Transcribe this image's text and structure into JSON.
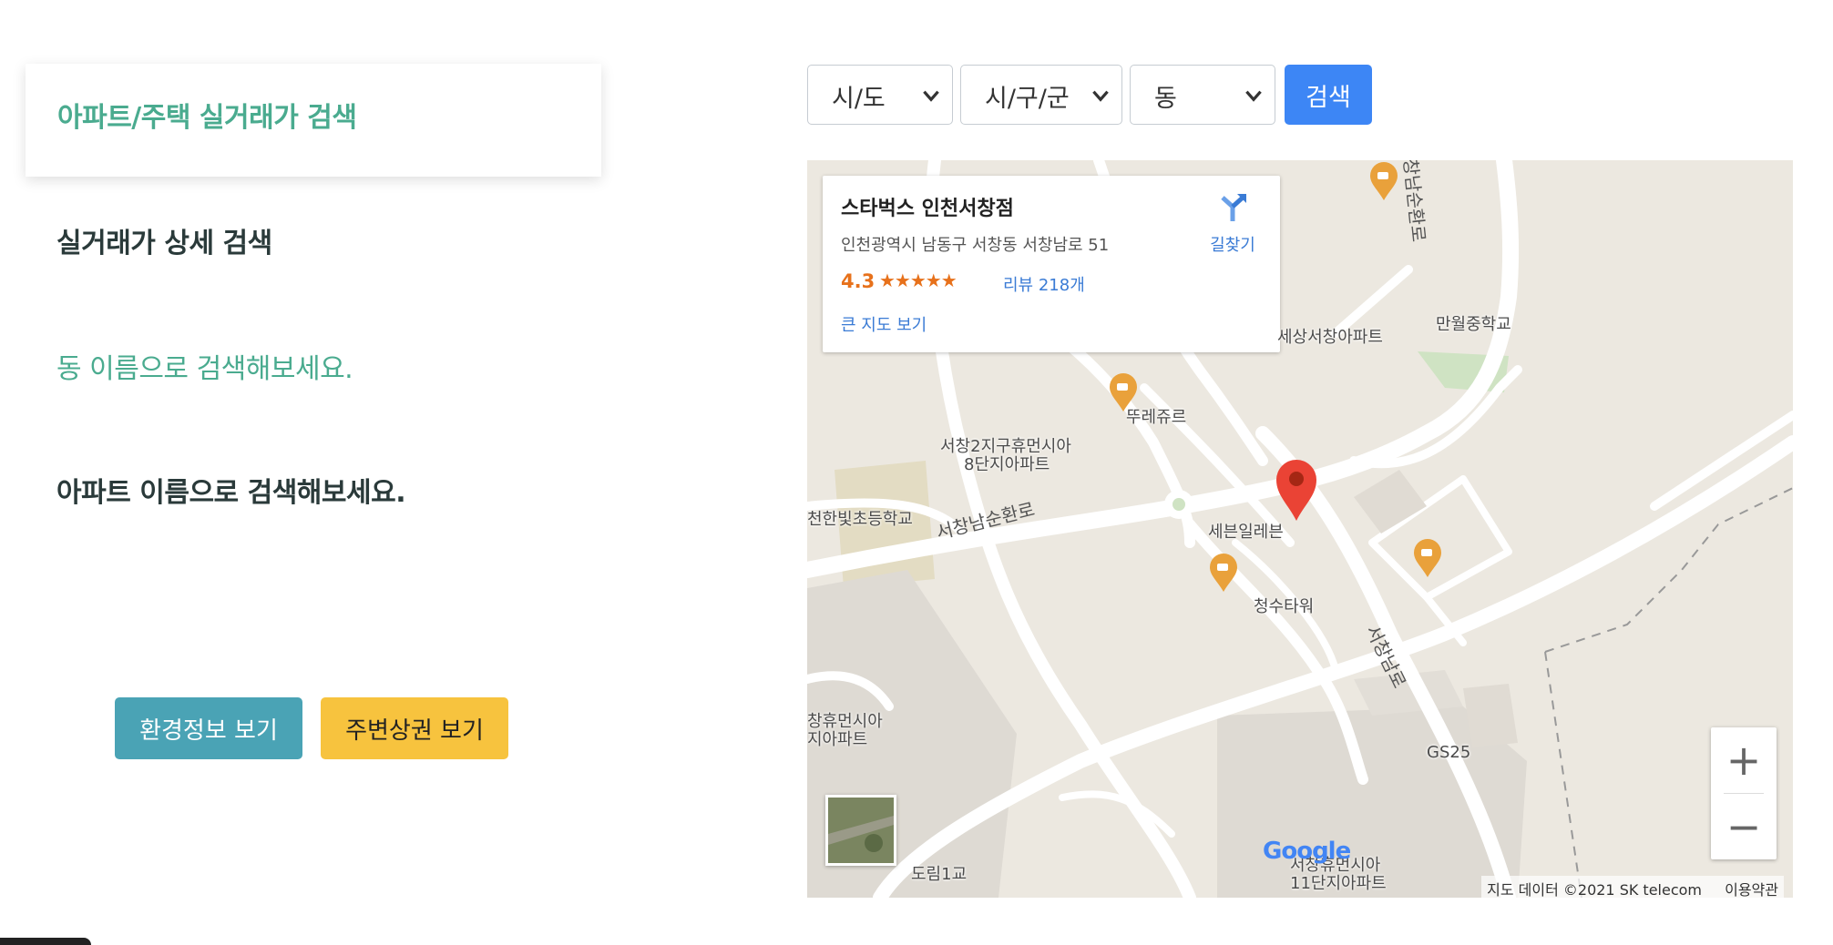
{
  "sidebar": {
    "title": "아파트/주택 실거래가 검색",
    "detail_search": "실거래가 상세 검색",
    "dong_hint": "동 이름으로 검색해보세요.",
    "apt_hint": "아파트 이름으로 검색해보세요.",
    "env_button": "환경정보 보기",
    "shop_button": "주변상권 보기"
  },
  "filters": {
    "sido": "시/도",
    "gugun": "시/구/군",
    "dong": "동",
    "search_button": "검색"
  },
  "map": {
    "info": {
      "name": "스타벅스 인천서창점",
      "address": "인천광역시 남동구 서창동 서창남로 51",
      "rating": "4.3",
      "stars": "★★★★★",
      "reviews": "리뷰 218개",
      "big_map_link": "큰 지도 보기",
      "directions": "길찾기"
    },
    "labels": {
      "sesang_apt": "세상서창아파트",
      "manwol_school": "만월중학교",
      "cafe_name": "뚜레쥬르",
      "apt_8": "서창2지구휴먼시아",
      "apt_8b": "8단지아파트",
      "elementary": "천한빛초등학교",
      "road_south": "서창남순환로",
      "seven_eleven": "세븐일레븐",
      "cheongsu": "청수타워",
      "road_main": "서창남로",
      "gs25": "GS25",
      "apt_left_a": "창휴먼시아",
      "apt_left_b": "지아파트",
      "apt_11a": "서창휴먼시아",
      "apt_11b": "11단지아파트",
      "bridge": "도림1교",
      "road_top": "서창남순환로"
    },
    "zoom_in": "+",
    "zoom_out": "−",
    "google": "Google",
    "attribution": "지도 데이터 ©2021 SK telecom",
    "terms": "이용약관"
  }
}
